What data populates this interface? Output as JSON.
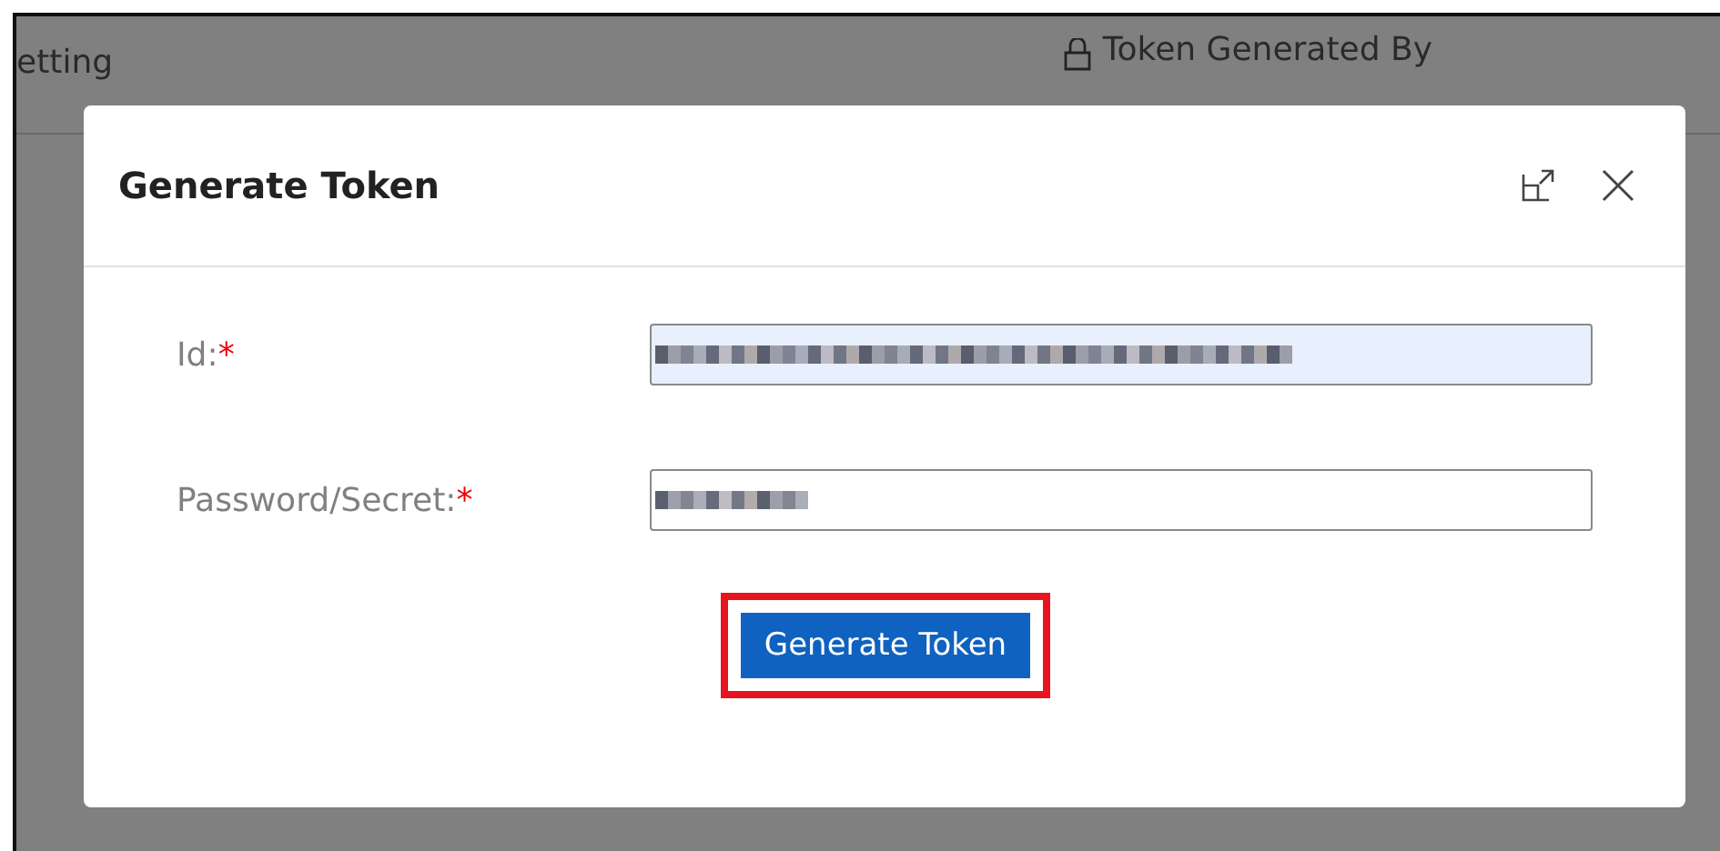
{
  "background": {
    "column_1": "etting",
    "column_2": {
      "title": "Token Generated By"
    }
  },
  "dialog": {
    "title": "Generate Token",
    "fields": [
      {
        "label": "Id:",
        "required_mark": "*",
        "autofilled": true,
        "kind": "text"
      },
      {
        "label": "Password/Secret:",
        "required_mark": "*",
        "autofilled": false,
        "kind": "password"
      }
    ],
    "button": {
      "label": "Generate Token",
      "highlighted": true
    }
  }
}
